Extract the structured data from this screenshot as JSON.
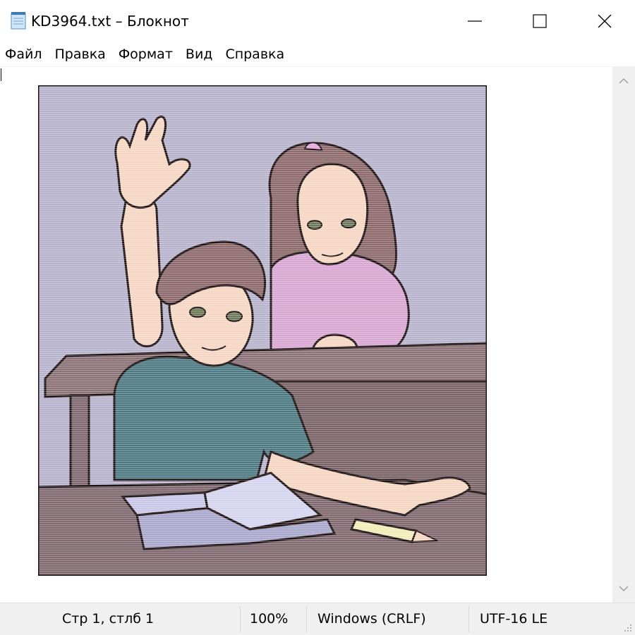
{
  "window": {
    "title": "KD3964.txt – Блокнот",
    "controls": {
      "minimize": "—",
      "maximize": "☐",
      "close": "✕"
    }
  },
  "menu": {
    "items": [
      {
        "label": "Файл"
      },
      {
        "label": "Правка"
      },
      {
        "label": "Формат"
      },
      {
        "label": "Вид"
      },
      {
        "label": "Справка"
      }
    ]
  },
  "editor": {
    "picture": {
      "icon": "classroom-illustration",
      "colors": {
        "background": "#b7b3cc",
        "desk": "#806a70",
        "skin": "#f5d6c2",
        "boy_shirt": "#4f7a84",
        "hair": "#8d6a6c",
        "girl_shirt": "#d7a6d3",
        "book": "#c7c6e6"
      }
    }
  },
  "statusbar": {
    "position": "Стр 1, стлб 1",
    "zoom": "100%",
    "line_endings": "Windows (CRLF)",
    "encoding": "UTF-16 LE"
  }
}
